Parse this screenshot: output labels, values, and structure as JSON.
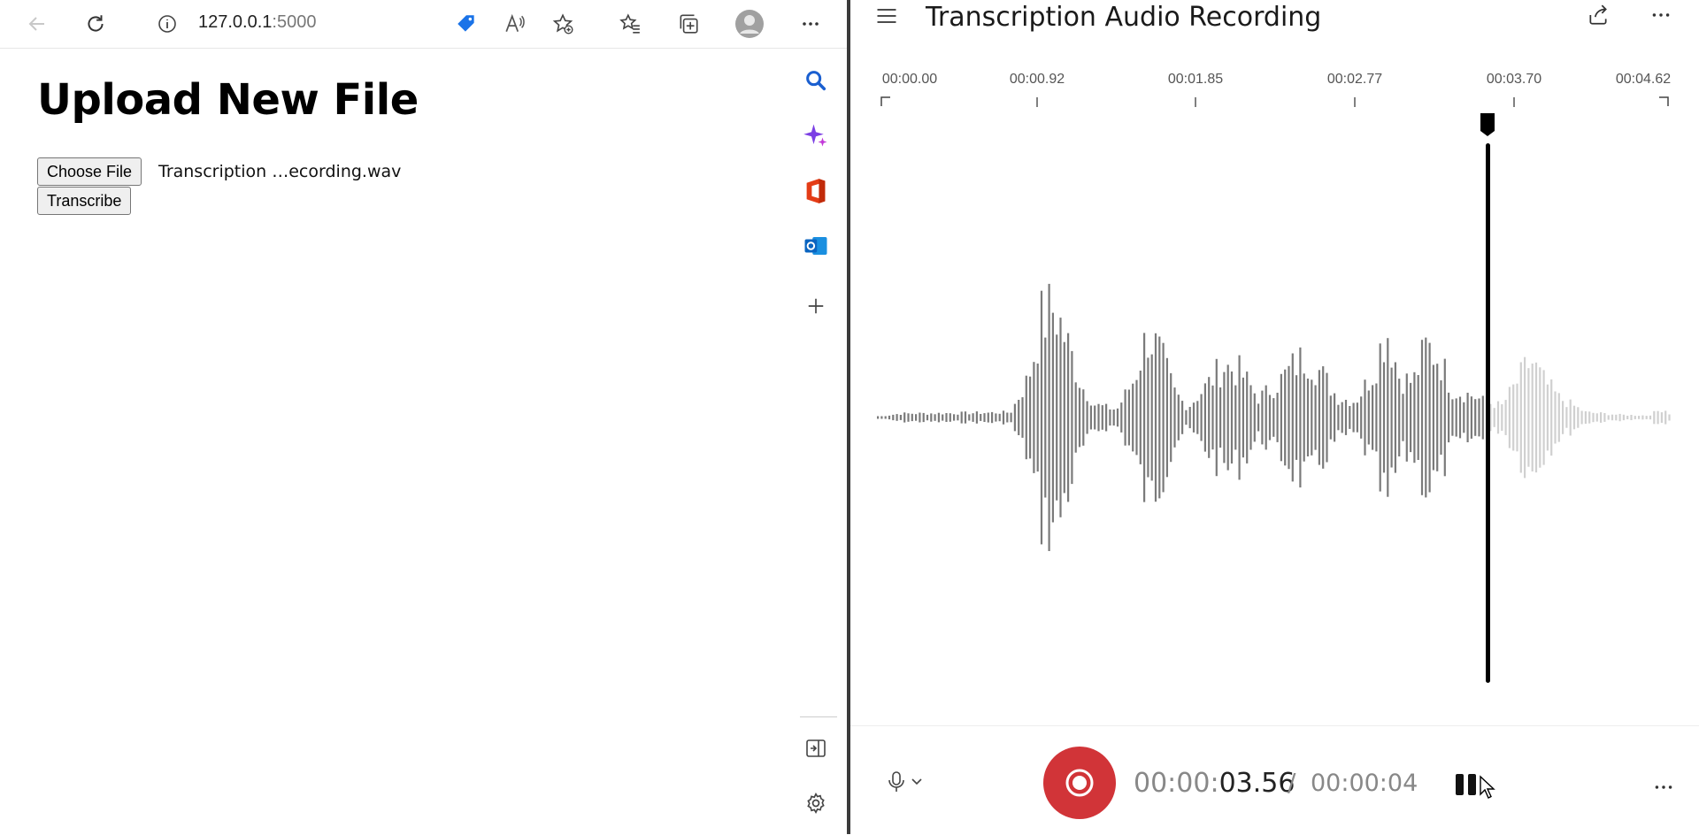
{
  "browser": {
    "url_host": "127.0.0.1",
    "url_port": ":5000",
    "icons": [
      "back-icon",
      "refresh-icon",
      "site-info-icon",
      "coupon-tag-icon",
      "read-aloud-icon",
      "add-favorite-icon",
      "favorites-icon",
      "collections-icon",
      "profile-icon",
      "more-icon"
    ]
  },
  "page": {
    "heading": "Upload New File",
    "choose_file_label": "Choose File",
    "file_name": "Transcription …ecording.wav",
    "transcribe_label": "Transcribe"
  },
  "sidebar": {
    "icons": [
      "search-icon",
      "copilot-icon",
      "office-icon",
      "outlook-icon",
      "add-icon",
      "split-screen-icon",
      "settings-icon"
    ]
  },
  "recorder": {
    "title": "Transcription Audio Recording",
    "timeline_ticks": [
      "00:00.00",
      "00:00.92",
      "00:01.85",
      "00:02.77",
      "00:03.70",
      "00:04.62"
    ],
    "playhead_seconds": 3.56,
    "duration_seconds": 4.62,
    "time_current_prefix": "00:00:",
    "time_current_main": "03.56",
    "time_separator": "/",
    "time_total": "00:00:04",
    "accent_color": "#d13438"
  }
}
